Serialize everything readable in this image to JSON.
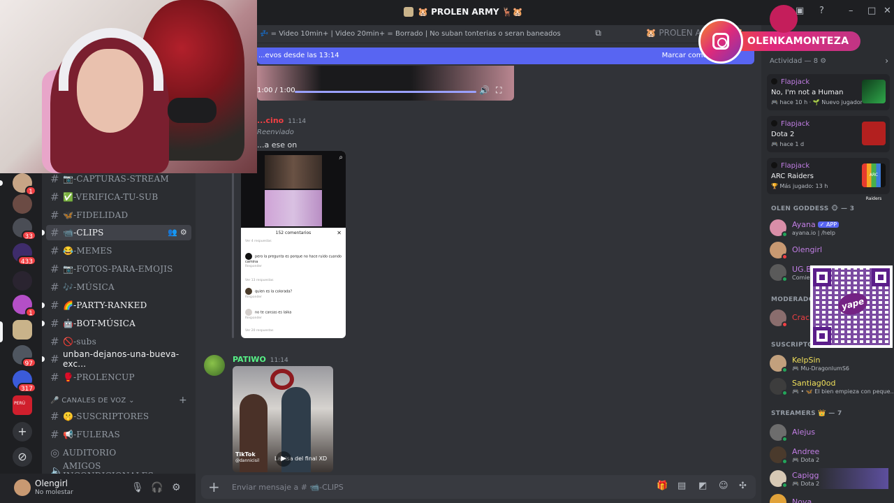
{
  "window": {
    "title": "🐹 PROLEN ARMY 🦌🐹"
  },
  "chat": {
    "topic": "💤 = Video 10min+ | Video 20min+ = Borrado | No suban tonterias o seran baneados",
    "server_short": "🐹 PROLEN ARMY 🦌🐹",
    "new_messages_banner": "...evos desde las 13:14",
    "mark_read": "Marcar como leído",
    "video_time": "1:00 / 1:00",
    "msg1": {
      "author": "...cino",
      "timestamp": "11:14",
      "forwarded": "Reenviado",
      "text": "...a ese on"
    },
    "tiktok_comments": {
      "title": "152 comentarios",
      "c1_user": "Ver 4 respuestas",
      "c2_text": "pero la pregunta es porque no hace ruido cuando camina",
      "c2_sub": "Responder",
      "c3_user": "Ver 13 respuestas",
      "c4_text": "quien es la colorada?",
      "c4_sub": "Responder",
      "c5_text": "no te cansas es laika",
      "c5_sub": "Responder",
      "c6_user": "Ver 20 respuestas"
    },
    "msg2": {
      "author": "PATIWO",
      "timestamp": "11:14",
      "tiktok_label": "TikTok",
      "tiktok_user": "@dannicisil",
      "caption": "La risa del final XD"
    },
    "composer_placeholder": "Enviar mensaje a # 📹-CLIPS"
  },
  "channels": [
    {
      "name": "📷-CAPTURAS-STREAM"
    },
    {
      "name": "✅-VERIFICA-TU-SUB"
    },
    {
      "name": "🦋-FIDELIDAD"
    },
    {
      "name": "📹-CLIPS"
    },
    {
      "name": "😂-MEMES"
    },
    {
      "name": "📷-FOTOS-PARA-EMOJIS"
    },
    {
      "name": "🎶-MÚSICA"
    },
    {
      "name": "🌈-PARTY-RANKED"
    },
    {
      "name": "🤖-BOT-MÚSICA"
    },
    {
      "name": "🚫-subs"
    },
    {
      "name": "unban-dejanos-una-bueva-exc..."
    },
    {
      "name": "🥊-PROLENCUP"
    }
  ],
  "voice_category": "CANALES DE VOZ",
  "voice_channels": [
    {
      "name": "🤫-SUSCRIPTORES"
    },
    {
      "name": "📢-FULERAS"
    },
    {
      "name": "AUDITORIO"
    },
    {
      "name": "AMIGOS INCONDICIONALES"
    }
  ],
  "servers": {
    "b1": "1",
    "b3": "33",
    "b4": "433",
    "b6": "1",
    "b8": "97",
    "b9": "317",
    "b10": "PERÚ"
  },
  "user": {
    "name": "Olengirl",
    "status": "No molestar"
  },
  "activity": {
    "header": "Actividad — 8",
    "cards": [
      {
        "who": "Flapjack",
        "game": "No, I'm not a Human",
        "meta": "🎮 hace 10 h · 🌱 Nuevo jugador"
      },
      {
        "who": "Flapjack",
        "game": "Dota 2",
        "meta": "🎮 hace 1 d"
      },
      {
        "who": "Flapjack",
        "game": "ARC Raiders",
        "meta": "🏆 Más jugado: 13 h"
      }
    ],
    "arc_thumb_text": "ARC Raiders"
  },
  "members": {
    "g1": "OLEN GODDESS 🐵 — 3",
    "ayana": "Ayana",
    "ayana_tag": "✓ APP",
    "ayana_sub": "ayana.io | /help",
    "olengirl": "Olengirl",
    "ugb": "UG.B",
    "ugb_sub": "Comie...",
    "g2": "MODERADO...",
    "crac": "Crac...",
    "g3": "SUSCRIPTO...",
    "kelpsin": "KelpSin",
    "kelpsin_sub": "🎮 Mu-DragonlumS6",
    "santiag": "Santiag0od",
    "santiag_sub": "🎮 • 🦋 El bien empieza con peque...",
    "g4": "STREAMERS 👑 — 7",
    "alejus": "Alejus",
    "andree": "Andree",
    "andree_sub": "🎮 Dota 2",
    "capigg": "Capigg",
    "capigg_sub": "🎮 Dota 2",
    "nova": "Nova"
  },
  "overlay": {
    "instagram_handle": "OLENKAMONTEZA",
    "yape": "yape"
  },
  "colors": {
    "accent": "#5865f2",
    "online": "#23a55a",
    "dnd": "#f23f43"
  }
}
